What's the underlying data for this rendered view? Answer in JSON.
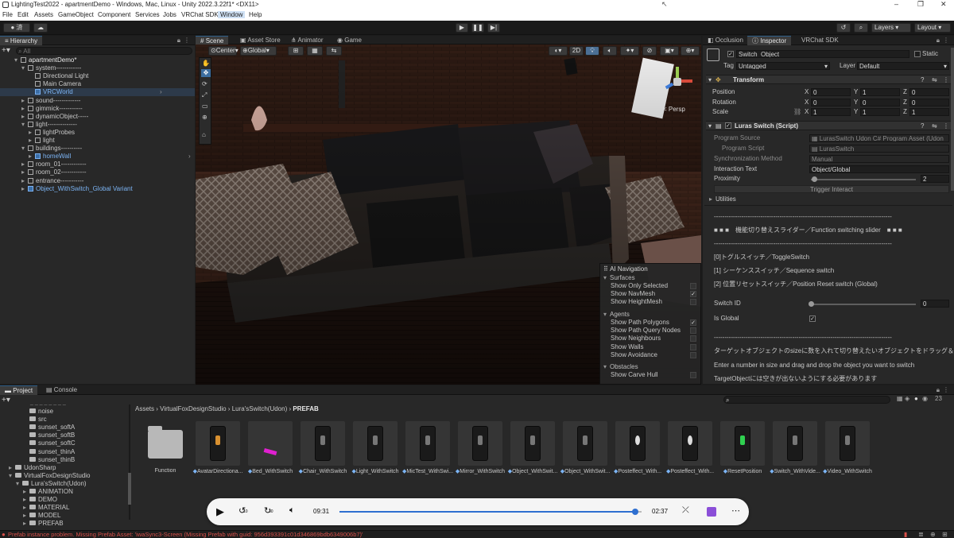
{
  "window": {
    "title": "LightingTest2022 - apartmentDemo - Windows, Mac, Linux - Unity 2022.3.22f1* <DX11>",
    "min": "–",
    "max": "❐",
    "close": "✕"
  },
  "menu": [
    "File",
    "Edit",
    "Assets",
    "GameObject",
    "Component",
    "Services",
    "Jobs",
    "VRChat SDK",
    "Window",
    "Help"
  ],
  "toolbar": {
    "account": "済",
    "layers": "Layers",
    "layout": "Layout"
  },
  "hierarchy": {
    "tab": "Hierarchy",
    "search_placeholder": "All",
    "items": [
      {
        "label": "apartmentDemo*",
        "depth": 0,
        "kind": "scene",
        "expanded": true
      },
      {
        "label": "system------------",
        "depth": 1,
        "kind": "object",
        "expanded": true
      },
      {
        "label": "Directional Light",
        "depth": 2,
        "kind": "object"
      },
      {
        "label": "Main Camera",
        "depth": 2,
        "kind": "object"
      },
      {
        "label": "VRCWorld",
        "depth": 2,
        "kind": "prefab"
      },
      {
        "label": "sound-------------",
        "depth": 1,
        "kind": "object",
        "expanded": false
      },
      {
        "label": "gimmick-----------",
        "depth": 1,
        "kind": "object",
        "expanded": false
      },
      {
        "label": "dynamicObject-----",
        "depth": 1,
        "kind": "object",
        "expanded": false
      },
      {
        "label": "light--------------",
        "depth": 1,
        "kind": "object",
        "expanded": true
      },
      {
        "label": "lightProbes",
        "depth": 2,
        "kind": "object",
        "expanded": false
      },
      {
        "label": "light",
        "depth": 2,
        "kind": "object",
        "expanded": false
      },
      {
        "label": "buildings----------",
        "depth": 1,
        "kind": "object",
        "expanded": true
      },
      {
        "label": "homeWall",
        "depth": 2,
        "kind": "prefab",
        "expanded": false
      },
      {
        "label": "room_01------------",
        "depth": 1,
        "kind": "object",
        "expanded": false
      },
      {
        "label": "room_02------------",
        "depth": 1,
        "kind": "object",
        "expanded": false
      },
      {
        "label": "entrance-----------",
        "depth": 1,
        "kind": "object",
        "expanded": false
      },
      {
        "label": "Object_WithSwitch_Global Variant",
        "depth": 1,
        "kind": "prefab",
        "expanded": false
      }
    ]
  },
  "scene": {
    "tabs": [
      "Scene",
      "Asset Store",
      "Animator",
      "Game"
    ],
    "pivot": "Center",
    "space": "Global",
    "mode2d": "2D",
    "persp": "< Persp",
    "navmesh": {
      "title": "AI Navigation",
      "surfaces": "Surfaces",
      "surfaces_items": [
        {
          "label": "Show Only Selected",
          "checked": false
        },
        {
          "label": "Show NavMesh",
          "checked": true
        },
        {
          "label": "Show HeightMesh",
          "checked": false
        }
      ],
      "agents": "Agents",
      "agents_items": [
        {
          "label": "Show Path Polygons",
          "checked": true
        },
        {
          "label": "Show Path Query Nodes",
          "checked": false
        },
        {
          "label": "Show Neighbours",
          "checked": false
        },
        {
          "label": "Show Walls",
          "checked": false
        },
        {
          "label": "Show Avoidance",
          "checked": false
        }
      ],
      "obstacles": "Obstacles",
      "obstacles_items": [
        {
          "label": "Show Carve Hull",
          "checked": false
        }
      ]
    }
  },
  "inspector": {
    "tabs": [
      "Occlusion",
      "Inspector",
      "VRChat SDK"
    ],
    "object_name": "Switch_Object",
    "static": "Static",
    "tag_label": "Tag",
    "tag": "Untagged",
    "layer_label": "Layer",
    "layer": "Default",
    "transform": {
      "title": "Transform",
      "position": {
        "label": "Position",
        "x": "0",
        "y": "1",
        "z": "0"
      },
      "rotation": {
        "label": "Rotation",
        "x": "0",
        "y": "0",
        "z": "0"
      },
      "scale": {
        "label": "Scale",
        "x": "1",
        "y": "1",
        "z": "1"
      }
    },
    "script": {
      "title": "Luras Switch (Script)",
      "program_source_label": "Program Source",
      "program_source": "LurasSwitch Udon C# Program Asset (Udon",
      "program_script_label": "Program Script",
      "program_script": "LurasSwitch",
      "sync_label": "Synchronization Method",
      "sync": "Manual",
      "interaction_label": "Interaction Text",
      "interaction": "Object/Global",
      "proximity_label": "Proximity",
      "proximity": "2",
      "trigger": "Trigger Interact",
      "utilities": "Utilities",
      "divider": "------------------------------------------------------------------------------------",
      "slider_title": "■ ■ ■　機能切り替えスライダー／Function switching slider　■ ■ ■",
      "divider2": "------------------------------------------------------------------------------------",
      "opt0": "[0]トグルスイッチ／ToggleSwitch",
      "opt1": "[1] シーケンススイッチ／Sequence switch",
      "opt2": "[2] 位置リセットスイッチ／Position Reset switch (Global)",
      "switch_id_label": "Switch ID",
      "switch_id": "0",
      "is_global_label": "Is Global",
      "is_global": true,
      "divider3": "------------------------------------------------------------------------------------",
      "note_jp": "ターゲットオブジェクトのsizeに数を入れて切り替えたいオブジェクトをドラッグ＆ドロップ",
      "note_en": "Enter a number in size and drag and drop the object you want to switch",
      "note_jp2": "TargetObjectには空きが出ないようにする必要があります"
    }
  },
  "project": {
    "tabs": [
      "Project",
      "Console"
    ],
    "count": "23",
    "breadcrumb": [
      "Assets",
      "VirtualFoxDesignStudio",
      "Lura'sSwitch(Udon)",
      "PREFAB"
    ],
    "tree": [
      {
        "label": "noise",
        "depth": 3
      },
      {
        "label": "src",
        "depth": 3
      },
      {
        "label": "sunset_softA",
        "depth": 3
      },
      {
        "label": "sunset_softB",
        "depth": 3
      },
      {
        "label": "sunset_softC",
        "depth": 3
      },
      {
        "label": "sunset_thinA",
        "depth": 3
      },
      {
        "label": "sunset_thinB",
        "depth": 3
      },
      {
        "label": "UdonSharp",
        "depth": 1
      },
      {
        "label": "VirtualFoxDesignStudio",
        "depth": 1
      },
      {
        "label": "Lura'sSwitch(Udon)",
        "depth": 2
      },
      {
        "label": "ANIMATION",
        "depth": 3
      },
      {
        "label": "DEMO",
        "depth": 3
      },
      {
        "label": "MATERIAL",
        "depth": 3
      },
      {
        "label": "MODEL",
        "depth": 3
      },
      {
        "label": "PREFAB",
        "depth": 3
      }
    ],
    "assets": [
      "Function",
      "AvatarDirectiona...",
      "Bed_WithSwitch",
      "Chair_WithSwitch",
      "Light_WithSwitch",
      "MicTest_WithSwi...",
      "Mirror_WithSwitch",
      "Object_WithSwit...",
      "Object_WithSwit...",
      "Posteffect_With...",
      "Posteffect_With...",
      "ResetPosition",
      "Switch_WithVide...",
      "Video_WithSwitch"
    ]
  },
  "video": {
    "current": "09:31",
    "duration": "02:37",
    "skip_back": "10",
    "skip_fwd": "30",
    "progress": 0.98
  },
  "status": {
    "error": "Prefab instance problem. Missing Prefab Asset: 'iwaSync3-Screen (Missing Prefab with guid: 956d393391c01d346869bdb6349006b7)'"
  },
  "colors": {
    "accent": "#2c5d87",
    "prefab": "#7cb4f4",
    "error": "#d8504a"
  }
}
